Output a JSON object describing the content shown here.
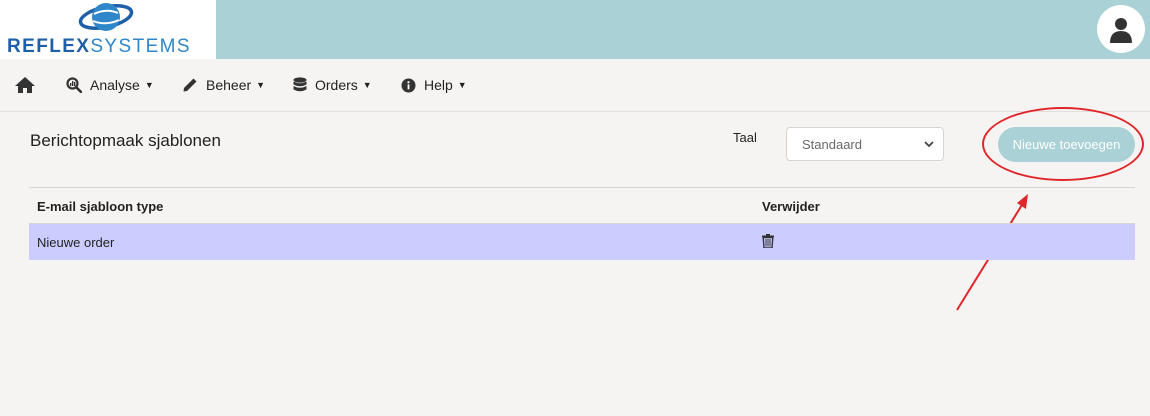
{
  "header": {
    "logo_primary": "REFLEX",
    "logo_secondary": "SYSTEMS",
    "brand_colors": {
      "primary": "#1f5fa8",
      "accent": "#2f86c8",
      "bar": "#a9d1d6"
    },
    "user_icon": "user-avatar-icon"
  },
  "nav": {
    "home_icon": "home-icon",
    "items": [
      {
        "label": "Analyse",
        "icon": "analyse-magnifier-icon"
      },
      {
        "label": "Beheer",
        "icon": "pencil-icon"
      },
      {
        "label": "Orders",
        "icon": "database-icon"
      },
      {
        "label": "Help",
        "icon": "info-circle-icon"
      }
    ]
  },
  "main": {
    "title": "Berichtopmaak sjablonen",
    "language_label": "Taal",
    "language_selected": "Standaard",
    "add_button_label": "Nieuwe toevoegen",
    "annotation_color": "#e0262a"
  },
  "table": {
    "headers": [
      "E-mail sjabloon type",
      "Verwijder"
    ],
    "rows": [
      {
        "type": "Nieuwe order",
        "delete_icon": "trash-icon"
      }
    ],
    "row_highlight_color": "#ccccff"
  }
}
